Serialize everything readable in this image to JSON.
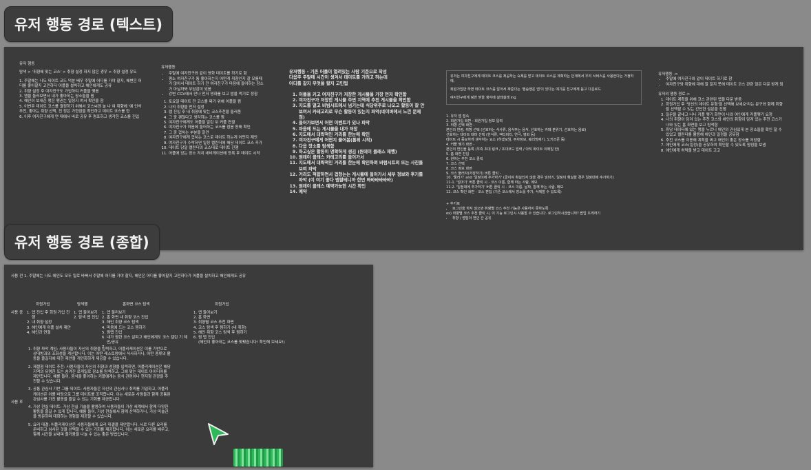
{
  "labels": {
    "text_path": "유저 행동 경로 (텍스트)",
    "combined_path": "유저 행동 경로 (종합)"
  },
  "text_panel": {
    "col1": {
      "title": "유저 행동",
      "intro": "탐색 > '휘향에 맞는 코스' > 취향 설정 하지 않은 경우 > 취향 설정 유도",
      "items": [
        "1. 주말에는 나도 데이트 코드 덕분 배우 주말에 어디를 가야 할지, 해변은 어디를 좋아할지 고민하다 어플을 설치하고 해인에게도 공유",
        "2. 취향 설정 후 여자친구도 가입하여 커플을 맺음",
        "3. 앱을 둘러보면서 내가 좋아하는 장소들을 찜",
        "4. 해인이 보내준 맹은 펭귄는 일정지 여서 확인을 함",
        "5. 이번주 데이트 코스를 결정하기 위해서 코스씨겐 눌 나 여 취향에 '에 인석 추천, 좋아는 취향 선택, 전 정은 가한점을 확인하고 데이트 코스를 한",
        "6. 이후 여자친구에게 연 대에서 바로 공유 후 평포하고 생각한 코스를 진입"
      ]
    },
    "col2": {
      "title": "유저행동",
      "bullets": [
        "주말에 여자친구와 같이 영화 데이트를 하기로 함",
        "평소 여자친구가 통 좋아하는지 어떤게 취향인지 잘 모를때가 많아서 데이트 하기 전 여자친구가 마음에 들어하는 장소가 아닐까봐 부담감이 있음",
        "강변 CGV에서 만나 먼저 영화를 보고 밥을 먹기로 정함"
      ],
      "items": [
        "토요일 데이트 전 코스를 짜기 위해 어플을 켬",
        "나의 취향을 먼저 설정",
        "랩 진입 후 내 취향에 맞는 코스추천을 둘러봄",
        "그 중 괜찮다고 생각하는 코스를 찜",
        "여자친구에게도 어플을 알린 뒤 커플 연결",
        "여자친구가 마음에 들어하는 코스를 접음 동해 확인",
        "그 중 겹치는 부분을 알견",
        "여자친구에게 겹치는 코스로 데이트 하는게 어떤지 제안",
        "여자친구가 수락하면 일정 캘린더에 해당 데이트 코스 추가",
        "데이트 당일 캘린더의 코스대로 데이트 진행",
        "어플에 있는 장소 저치 네비게이션에 등록 후 데이트 시작"
      ]
    },
    "col3": {
      "title_lines": [
        "유저행동 - 기존 어플이 열려있는 사람 기준으로 작성",
        "다음주 주말에 시간이 생겨서 데이트를 가려고 하는데",
        "어디를 갈지 무엇을 할지 고민됨"
      ],
      "items": [
        "어플을 키고 여자친구가 저장한 게시물을 가장 먼저 확인함",
        "여자친구가 저장한 게시물 주변 지역에 추천 게시물을 확인함",
        "지도를 열고 비빔시트에서 넘기는데 식당위주로 나오고 활동이 잘 안보여서 카테고리로 무슨 활동이 있는지 파악(네이버에서 느낀 문제점)",
        "들어가보면서 어떤 이벤트가 있나 파악",
        "마음에 드는 게시물을 내가 저장",
        "지도에서 대략적인 거리를 한눈에 확인",
        "여자친구에게 어떤지 물어봄(통위 시작)",
        "다음 장소를 탐색함",
        "하고싶은 활동이 명확하게 생김 (원데이 클래스 재행)",
        "원데이 클래스 카테고리를 들어가서",
        "지도에서 대략적인 거리를 한눈에 확인하며 바텀시트의 뜨는 사진을 보며 파악",
        "거리도 적합하면서 겹쳤는는 게시물에 들어가서 세부 정보와 후기를 파악 (이 여기 좋다 멤할테니까 한번 봐바바바바바)",
        "원데이 클래스 예약가능한 시간 확인",
        "예약"
      ]
    },
    "col4": {
      "box_lines": [
        "유저는 여자친구에게 데이트 코스를 제공하는 숙제를 받고 데이트 코스를 계획하는 단계에서 우리 서비스를 사용한다는 가정하에,",
        "회원가입만 하면 데이트 코스를 알아서 짜준다는 '행승행운 앱'이 있다는 얘기를 친구에게 듣고 다운로드",
        "여자친구에게 링한 받을 생각에 설레설레 ing"
      ],
      "items": [
        "1. 유저 앱 접속",
        "2. 회원가입 화면 - 회원가입 정보 입력",
        "3. 취향 선택 화면 -",
        "본인의 연령, 취향 선택 (선호하는 식사류, 음식주는 음식, 선호하는 카페 분위기, 선호하는 음료)",
        "선호하는 데이트 테마 선택 (한식류, 액티비티, 연극, 영화 등)",
        "데이트 시 중요하게 생각하는 요소 (하겠모임, 주차정보, 웨리빙예기, 노키즈존 등)",
        "4. 커플 맺기 화면 -",
        "본인의 연인을 등록 (우측 초대 링크 / 초대코드 입력 / 아직 화이트 이메일 한)",
        "5. 홈 화면 진입",
        "6. 원하는 추천 코스 클릭",
        "7. 코스 선택",
        "8. 코스 정보 화면",
        "9. 코스 둘러자(저장하기) 버튼 클릭 -",
        "10. '둘러기' and '일정이에 추가하기' (골이야 확실되지 않을 경우 엄마기, 일정이 확실할 경우 일정대에 추가하기)",
        "11-1. '엄마기' 버튼 클릭 시 - 코스 이름, 함께 하는 사람, 메모",
        "11-2. '일정대에 추가하기' 버튼 클릭 시 - 코스 이름, 날짜, 함께 하는 사람, 메모",
        "12. 코스 확인 화면 - 코스 편집 (기존 코스에서 장소를 추가, 삭제할 수 있도록)"
      ],
      "extra_title": "+ 추가로",
      "extra": [
        "로그인을 하지 않으면 취향별 코스 추천 기능은 사용하지 못하도록",
        "ex) 취향별 코스 추천 클릭 시, 이 기능 로그인시 사용할 수 있습니다. 로그인하시겠습니까? 팝업 뜨게하기",
        "취향 / 맵팁더 연인 간 공유"
      ]
    },
    "col5": {
      "title": "유저행동 ->",
      "bullets": [
        "주말에 여자친구와 같이 데이트 하기로 함",
        "여자친구와 취향에 대해 잘 알지 못해 데이트 코스 관련 많은 다운 받게 됨"
      ],
      "subtitle": "유저의 행동 경로->",
      "items": [
        "데이트 계획을 위해 코스 관련된 앱을 다운 받음",
        "회원가입 후 '당신의 데이트 유형'을 선택해 보세요'라는 문구와 함께 취향을 선택할 수 있는 간단한 설문을 진행",
        "질문을 끝내고 나니 커플 맺기 화면이 나와 여인에게 커플맺기 요청",
        "나의 취향이 담겨 있는 추천 코스와 애인의 취향이 담겨 있는 추천 코스가 나와 있는 홈 화면을 보고 탐색함",
        "취당 데이터에 있는 맹을 누르니 애인의 관심있게 본 장소들을 확인 할 수 있었고 캘린더를 활용해 애인과 일정을 공유함",
        "추천 코스를 이용해 계획을 짜고 애인이 좋은 장소를 저장함",
        "애인에게 코스(일정)을 공유하여 확인할 수 있도록 맘림을 보냄",
        "애인에게 허락을 받고 데이트 고고"
      ]
    }
  },
  "combined_panel": {
    "top_line": "사용 전 1. 주말에는 나도 에인도 모두 일로 바빠서 주말에 어디를 가야 할지, 해인은 어디를 좋아할지 고민하다가 어플을 설치하고 해인에게도 공유",
    "headers": {
      "signup": "회원가입",
      "explore": "탐색행",
      "recommend": "홈화면 코스 탐색",
      "signup2": "회원가입"
    },
    "row_label_use": "사용 중",
    "signup_items": [
      "앱 진입 후 회원 가입 진행",
      "내 취향 설정",
      "해인에게 어플 설치 제안",
      "해인과 연결"
    ],
    "explore_items": [
      "앱 들어보기",
      "탐색 맵 진입"
    ],
    "recommend_items": [
      "앱 둘러보기",
      "홈 화면 내 취향 코스 진입",
      "해인 취향 코스 탐색",
      "마음에 드는 코스 찜하기",
      "찜탭 진입",
      "내가 찜한 코스 살피고 해인에게도 코스 캘린 기 제안/공유",
      ""
    ],
    "signup2_items": [
      "앱 들어보기",
      "홈 화면",
      "취향별 코스 추천 화면",
      "코스 탐색 후 찜하기 (내 취향)",
      "해인 취향 코스 탐색 후 찜하기",
      "찜 탭 진입",
      "(해인이 좋아하는 코스를 맞췄습니다! 확인해 보세요!)"
    ],
    "row_label_after": "사용 후",
    "after_items": [
      "취향 파악 계임: 사용자들이 자신의 취향을 입력하고, 어플리케이션은 이를 기반으로 상대방과의 조화성을 계산합니다. 이는 어떤 레스토랑에서 식사하거나, 어떤 종류의 활동을 즐길지에 대한 제안을 개인화하게 제공할 수 있습니다.",
      "제절형 데이트 추천: 사용자들이 자신의 취향과 성향을 입력하면, 어플리케이션은 해당 지역의 유명한 또는 숨겨진 로케일로 장소를 탐색하고, 그에 맞는 데이트 아이디어를 제안합니다. 예를 들어, 음식을 좋아하는 커플에게는 음식 관련이나 현지형 관광을 추천할 수 있습니다.",
      "공통 관심사 기반 그룹 데이트: 사용자들은 자신의 관심사나 취미를 기입하고, 어플리케이션은 이를 바탕으로 그룹 데이트를 조직합니다. 이는 새로운 사람들과 함께 공통된 관심사를 가진 활동을 즐길 수 있는 기회를 제공합니다.",
      "가상 현실 데이트: 가상 현실 기술을 활용하여 사용자들이 가상 세계에서 함께 다양한 활동을 즐길 수 있게 합니다. 예를 들어, 가상 현실에서 함께 산책하거나, 가상 미술관을 방문하며 대화하는 경험을 제공할 수 있습니다.",
      "요리 대결: 어플리케이션은 사용자들에게 요리 대결을 제안합니다. 서로 다른 요리를 준비하고 심사된 것을 선택할 수 있는 기회를 제공합니다. 이는 새로운 요리를 배우고, 함께 시간을 보내며 즐거움을 나눌 수 있는 좋은 방법입니다."
    ]
  },
  "colors": {
    "background": "#8a8a8a",
    "panel": "#3b3b3b",
    "text": "#e6e6e6",
    "cursor": "#2fb85a"
  },
  "icons": {
    "cursor": "cursor-arrow-icon"
  }
}
